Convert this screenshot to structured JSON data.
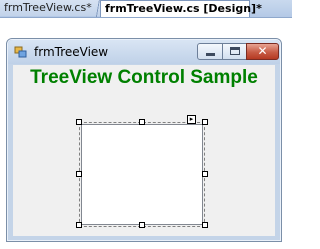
{
  "tabs": [
    {
      "label": "frmTreeView.cs*",
      "active": false
    },
    {
      "label": "frmTreeView.cs [Design]*",
      "active": true
    }
  ],
  "window": {
    "title": "frmTreeView",
    "icon": "form-icon",
    "buttons": {
      "minimize": "minimize-icon",
      "maximize": "maximize-icon",
      "close": "close-icon"
    },
    "close_glyph": "✕"
  },
  "form": {
    "heading": "TreeView Control Sample",
    "heading_color": "#008000"
  },
  "smart_tag_glyph": "▸"
}
